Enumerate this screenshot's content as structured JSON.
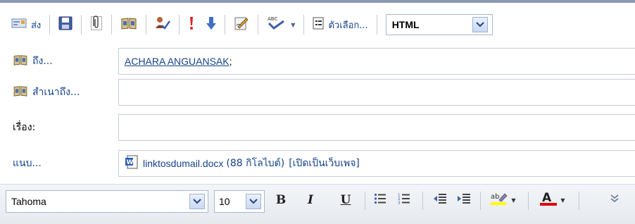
{
  "toolbar": {
    "send_label": "ส่ง",
    "options_label": "ตัวเลือก...",
    "format_value": "HTML",
    "icons": {
      "send": "send-envelope-icon",
      "save": "floppy-disk-icon",
      "attach": "paperclip-icon",
      "address_book": "address-book-icon",
      "check_names": "check-names-icon",
      "high_importance": "exclamation-icon",
      "low_importance": "down-arrow-icon",
      "signature": "signature-pen-icon",
      "spell_check": "spell-check-icon",
      "options": "options-page-icon"
    }
  },
  "header": {
    "to_label": "ถึง...",
    "to_recipient": "ACHARA ANGUANSAK",
    "to_separator": ";",
    "cc_label": "สำเนาถึง...",
    "cc_value": "",
    "subject_label": "เรื่อง:",
    "subject_value": "",
    "attach_label": "แนบ...",
    "attachment": {
      "name": "linktosdumail.docx",
      "size": "(88 กิโลไบต์)",
      "open_as_web": "[เปิดเป็นเว็บเพจ]"
    }
  },
  "format_toolbar": {
    "font": "Tahoma",
    "size": "10",
    "bold": "B",
    "italic": "I",
    "underline": "U",
    "font_color_glyph": "A",
    "highlight_glyph": "ab",
    "colors": {
      "highlight": "#ffff00",
      "font_color": "#e00000",
      "link": "#15428b"
    }
  }
}
